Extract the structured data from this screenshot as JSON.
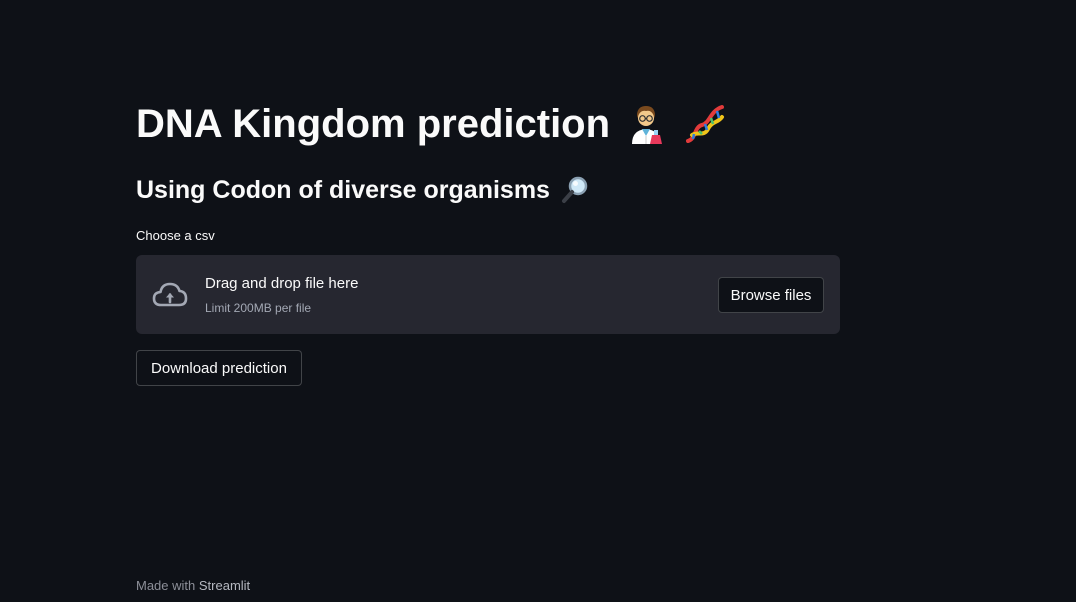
{
  "page": {
    "title": "DNA Kingdom prediction",
    "title_emojis": [
      "scientist-icon",
      "dna-icon"
    ],
    "subtitle": "Using Codon of diverse organisms",
    "subtitle_emoji": "magnifying-glass-icon"
  },
  "uploader": {
    "label": "Choose a csv",
    "drop_text": "Drag and drop file here",
    "limit_text": "Limit 200MB per file",
    "browse_label": "Browse files",
    "icon": "cloud-upload-icon"
  },
  "download": {
    "label": "Download prediction"
  },
  "footer": {
    "made_with": "Made with",
    "brand": "Streamlit"
  },
  "colors": {
    "background": "#0e1117",
    "dropzone": "#262730",
    "text": "#fafafa",
    "muted": "#a3a8b4"
  }
}
